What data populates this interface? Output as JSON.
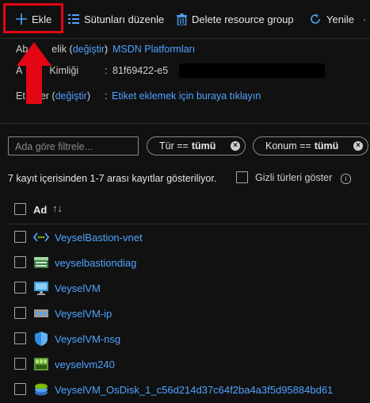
{
  "toolbar": {
    "add_label": "Ekle",
    "columns_label": "Sütunları düzenle",
    "delete_label": "Delete resource group",
    "refresh_label": "Yenile"
  },
  "essentials": {
    "subscription_label_prefix": "Ab",
    "subscription_label_mid": "elik (",
    "subscription_change": "değiştir",
    "subscription_label_suffix": ")",
    "subscription_value": "MSDN Platformları",
    "subscription_id_label": "A",
    "subscription_id_label_rest": "Kimliği",
    "subscription_id_value": "81f69422-e5",
    "tags_label": "Et",
    "tags_label_rest": "er (",
    "tags_change": "değiştir",
    "tags_label_suffix": ")",
    "tags_value": "Etiket eklemek için buraya tıklayın",
    "colon": ":"
  },
  "filters": {
    "name_placeholder": "Ada göre filtrele...",
    "type_prefix": "Tür ==",
    "type_value": "tümü",
    "location_prefix": "Konum ==",
    "location_value": "tümü"
  },
  "list": {
    "count_text": "7 kayıt içerisinden 1-7 arası kayıtlar gösteriliyor.",
    "show_hidden": "Gizli türleri göster",
    "column_name": "Ad",
    "items": [
      {
        "name": "VeyselBastion-vnet",
        "icon": "vnet-icon"
      },
      {
        "name": "veyselbastiondiag",
        "icon": "storage-account-icon"
      },
      {
        "name": "VeyselVM",
        "icon": "virtual-machine-icon"
      },
      {
        "name": "VeyselVM-ip",
        "icon": "public-ip-icon"
      },
      {
        "name": "VeyselVM-nsg",
        "icon": "network-security-group-icon"
      },
      {
        "name": "veyselvm240",
        "icon": "network-interface-icon"
      },
      {
        "name": "VeyselVM_OsDisk_1_c56d214d37c64f2ba4a3f5d95884bd61",
        "icon": "disk-icon"
      }
    ]
  },
  "colors": {
    "background": "#111111",
    "link": "#4fa3ff",
    "annotation_red": "#e30613"
  }
}
